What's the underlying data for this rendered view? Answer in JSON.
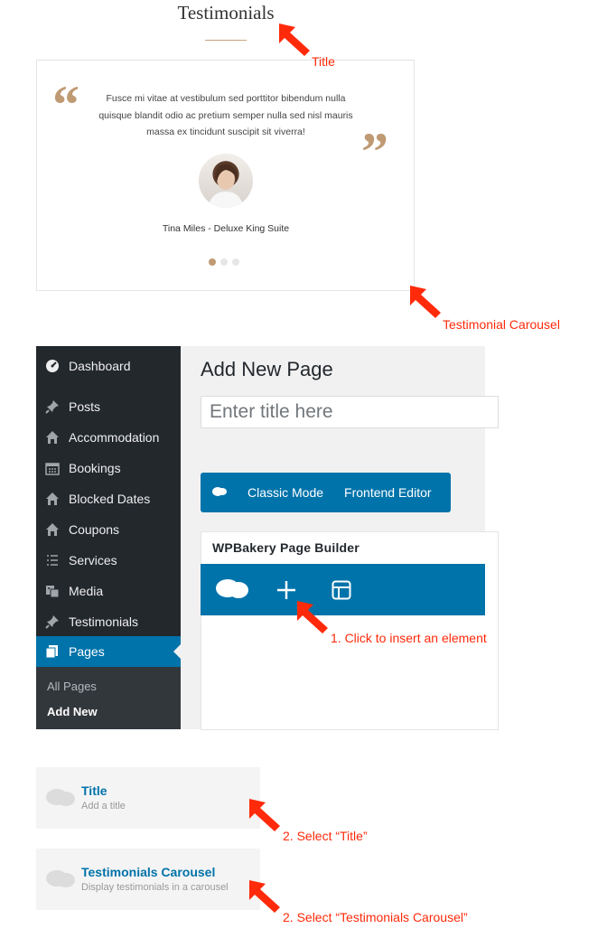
{
  "preview": {
    "title": "Testimonials",
    "quote_open": "“",
    "quote_close": "”",
    "text": "Fusce mi vitae at vestibulum sed porttitor bibendum nulla quisque blandit odio ac pretium semper nulla sed nisl mauris massa ex tincidunt suscipit sit viverra!",
    "author": "Tina Miles - Deluxe King Suite",
    "dots": 3,
    "active_dot": 0,
    "accent_color": "#bf9a73"
  },
  "annotations": {
    "title": "Title",
    "carousel": "Testimonial Carousel",
    "step1": "1. Click to insert an element",
    "step2_title": "2. Select “Title”",
    "step2_carousel": "2. Select “Testimonials Carousel”",
    "color": "#ff2a0a"
  },
  "admin": {
    "menu": [
      {
        "label": "Dashboard",
        "icon": "dashboard-icon"
      },
      {
        "label": "Posts",
        "icon": "pin-icon"
      },
      {
        "label": "Accommodation",
        "icon": "home-icon"
      },
      {
        "label": "Bookings",
        "icon": "calendar-icon"
      },
      {
        "label": "Blocked Dates",
        "icon": "home-icon"
      },
      {
        "label": "Coupons",
        "icon": "home-icon"
      },
      {
        "label": "Services",
        "icon": "list-icon"
      },
      {
        "label": "Media",
        "icon": "media-icon"
      },
      {
        "label": "Testimonials",
        "icon": "pin-icon"
      },
      {
        "label": "Pages",
        "icon": "pages-icon",
        "active": true
      }
    ],
    "submenu": {
      "all_pages": "All Pages",
      "add_new": "Add New"
    },
    "page_heading": "Add New Page",
    "title_placeholder": "Enter title here",
    "wpb": {
      "classic_mode": "Classic Mode",
      "frontend_editor": "Frontend Editor",
      "panel_title": "WPBakery Page Builder"
    },
    "colors": {
      "sidebar": "#23282d",
      "accent": "#0073aa"
    }
  },
  "elements": [
    {
      "name": "Title",
      "desc": "Add a title"
    },
    {
      "name": "Testimonials Carousel",
      "desc": "Display testimonials in a carousel"
    }
  ]
}
